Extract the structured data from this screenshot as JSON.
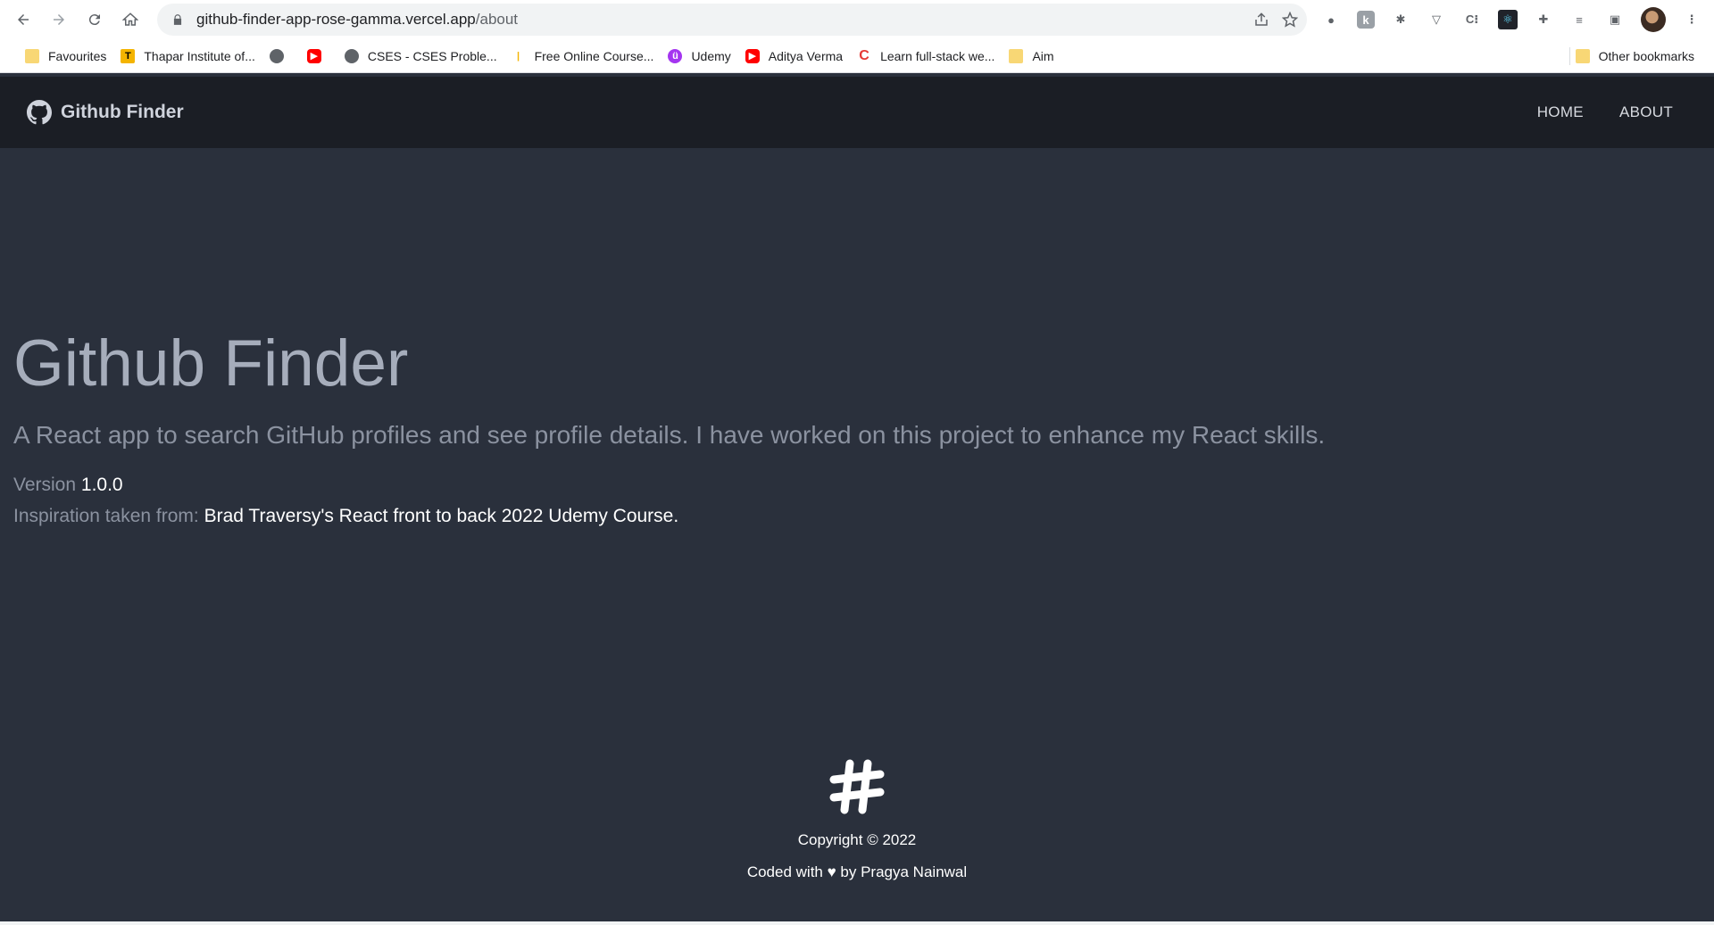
{
  "browser": {
    "url_host": "github-finder-app-rose-gamma.vercel.app",
    "url_path": "/about",
    "bookmarks": [
      {
        "label": "Favourites",
        "icon": "folder-icon"
      },
      {
        "label": "Thapar Institute of...",
        "icon": "thapar-icon"
      },
      {
        "label": "",
        "icon": "globe-icon"
      },
      {
        "label": "",
        "icon": "youtube-icon"
      },
      {
        "label": "CSES - CSES Proble...",
        "icon": "globe-icon"
      },
      {
        "label": "Free Online Course...",
        "icon": "bars-icon"
      },
      {
        "label": "Udemy",
        "icon": "udemy-icon"
      },
      {
        "label": "Aditya Verma",
        "icon": "youtube-icon"
      },
      {
        "label": "Learn full-stack we...",
        "icon": "c-icon"
      },
      {
        "label": "Aim",
        "icon": "folder-icon"
      }
    ],
    "other_bookmarks": "Other bookmarks"
  },
  "nav": {
    "brand": "Github Finder",
    "links": [
      "HOME",
      "ABOUT"
    ]
  },
  "about": {
    "title": "Github Finder",
    "description": "A React app to search GitHub profiles and see profile details. I have worked on this project to enhance my React skills.",
    "version_label": "Version",
    "version_value": "1.0.0",
    "inspiration_label": "Inspiration taken from:",
    "inspiration_value": "Brad Traversy's React front to back 2022 Udemy Course."
  },
  "footer": {
    "copyright": "Copyright © 2022",
    "credit": "Coded with ♥ by Pragya Nainwal"
  },
  "colors": {
    "nav_bg": "#1b1e25",
    "page_bg": "#2a303c"
  }
}
